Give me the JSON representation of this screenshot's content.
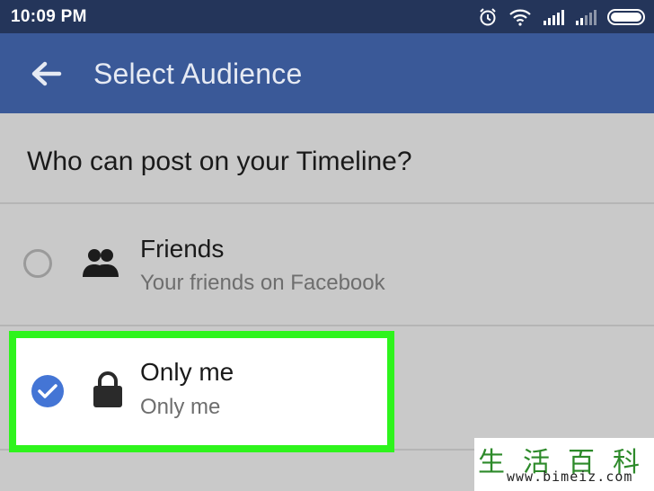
{
  "status_bar": {
    "time": "10:09 PM",
    "icons": [
      "alarm-icon",
      "wifi-icon",
      "cellular-signal-icon",
      "cellular-signal-2-icon",
      "battery-icon"
    ]
  },
  "app_bar": {
    "back_icon": "back-arrow-icon",
    "title": "Select Audience"
  },
  "question": "Who can post on your Timeline?",
  "options": [
    {
      "icon": "friends-icon",
      "title": "Friends",
      "subtitle": "Your friends on Facebook",
      "selected": false
    },
    {
      "icon": "lock-icon",
      "title": "Only me",
      "subtitle": "Only me",
      "selected": true
    }
  ],
  "colors": {
    "status_bar": "#24355a",
    "app_bar": "#3a5998",
    "highlight_border": "#2ef41c",
    "radio_selected": "#4475d5"
  },
  "watermark": {
    "chars": [
      "生",
      "活",
      "百",
      "科"
    ],
    "url": "www.bimeiz.com"
  }
}
